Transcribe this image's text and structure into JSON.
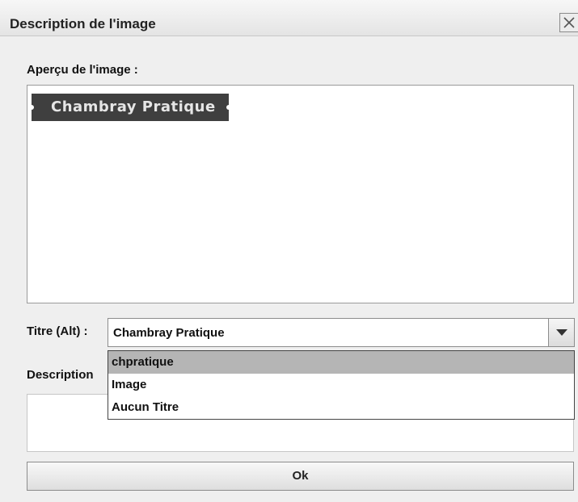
{
  "window": {
    "title": "Description de l'image",
    "close_icon": "close-icon"
  },
  "preview": {
    "label": "Aperçu de l'image :",
    "image_text": "Chambray Pratique"
  },
  "titre": {
    "label": "Titre (Alt) :",
    "value": "Chambray Pratique",
    "arrow_icon": "triangle-down-icon",
    "options": [
      "chpratique",
      "Image",
      "Aucun Titre"
    ],
    "highlighted_option": "chpratique"
  },
  "description": {
    "label": "Description"
  },
  "ok_button": {
    "label": "Ok"
  },
  "colors": {
    "dialog_bg": "#efefef",
    "highlight": "#b5b5b5",
    "image_bg": "#3f3f3f"
  }
}
